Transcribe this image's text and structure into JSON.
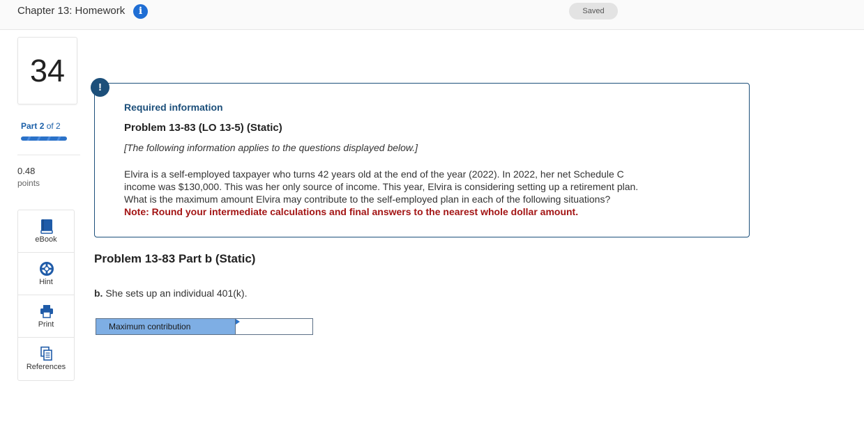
{
  "header": {
    "assignment_title": "Chapter 13: Homework",
    "save_status": "Saved"
  },
  "question": {
    "number": "34",
    "part_label": "Part",
    "part_current": "2",
    "part_of": "of 2",
    "points_value": "0.48",
    "points_label": "points"
  },
  "tools": [
    {
      "label": "eBook",
      "icon": "book-icon"
    },
    {
      "label": "Hint",
      "icon": "lifebuoy-icon"
    },
    {
      "label": "Print",
      "icon": "printer-icon"
    },
    {
      "label": "References",
      "icon": "copy-documents-icon"
    }
  ],
  "info_panel": {
    "badge": "!",
    "heading": "Required information",
    "problem_title": "Problem 13-83 (LO 13-5) (Static)",
    "applies_note": "[The following information applies to the questions displayed below.]",
    "scenario_lines": [
      "Elvira is a self-employed taxpayer who turns 42 years old at the end of the year (2022). In 2022, her net Schedule C",
      "income was $130,000. This was her only source of income. This year, Elvira is considering setting up a retirement plan.",
      "What is the maximum amount Elvira may contribute to the self-employed plan in each of the following situations?"
    ],
    "note": "Note: Round your intermediate calculations and final answers to the nearest whole dollar amount."
  },
  "part_b": {
    "title": "Problem 13-83 Part b (Static)",
    "letter": "b.",
    "text": "She sets up an individual 401(k).",
    "answer_label": "Maximum contribution",
    "answer_value": ""
  },
  "colors": {
    "accent": "#1c4f7a",
    "link": "#1a5fa8",
    "note_red": "#a31515",
    "answer_label_bg": "#7eaee4",
    "info_icon": "#1f6ed4"
  }
}
